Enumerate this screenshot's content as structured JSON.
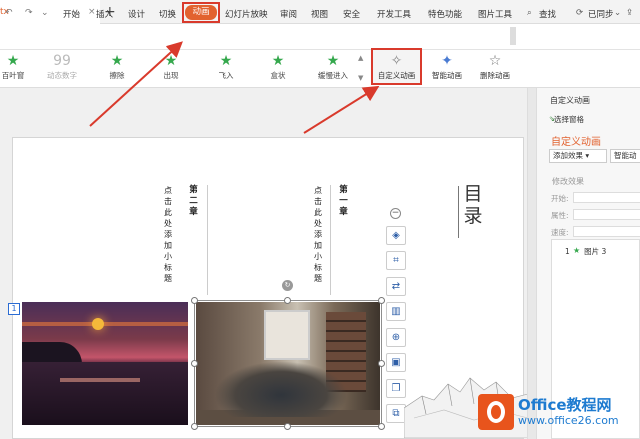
{
  "tabstrip": {
    "doc_tab": "tx",
    "close": "×",
    "new_tab": "+"
  },
  "menubar": {
    "quick": [
      "↶",
      "↷",
      "⌄"
    ],
    "items": [
      "开始",
      "插入",
      "设计",
      "切换",
      "动画",
      "幻灯片放映",
      "审阅",
      "视图",
      "安全",
      "开发工具",
      "特色功能",
      "图片工具"
    ],
    "active": "动画",
    "search": "查找",
    "sync": "已同步",
    "extra": "⌄"
  },
  "ribbon": {
    "effects": [
      "百叶窗",
      "动态数字",
      "擦除",
      "出现",
      "飞入",
      "盒状",
      "缓慢进入"
    ],
    "custom": "自定义动画",
    "smart": "智能动画",
    "delete": "删除动画"
  },
  "slide": {
    "number": "1",
    "col2_head": "第二章",
    "col2_text": "点击此处添加小标题",
    "col1_head": "第一章",
    "col1_text": "点击此处添加小标题",
    "catalog": "目录"
  },
  "float_toolbar": {
    "collapse": "−",
    "icons": [
      "layers-icon",
      "crop-icon",
      "replace-icon",
      "layout-icon",
      "zoom-icon",
      "frame-icon",
      "copy-icon",
      "more-icon"
    ]
  },
  "pane": {
    "title": "自定义动画",
    "select_pane": "选择窗格",
    "heading": "自定义动画",
    "add_effect": "添加效果",
    "smart": "智能动",
    "modify": "修改效果",
    "start": "开始:",
    "property": "属性:",
    "speed": "速度:",
    "item": "1",
    "item_name": "图片 3"
  },
  "watermark": {
    "name": "Office教程网",
    "url": "www.office26.com"
  },
  "colors": {
    "accent": "#e2622f",
    "annotation": "#d93a2c",
    "star": "#35a84d"
  }
}
